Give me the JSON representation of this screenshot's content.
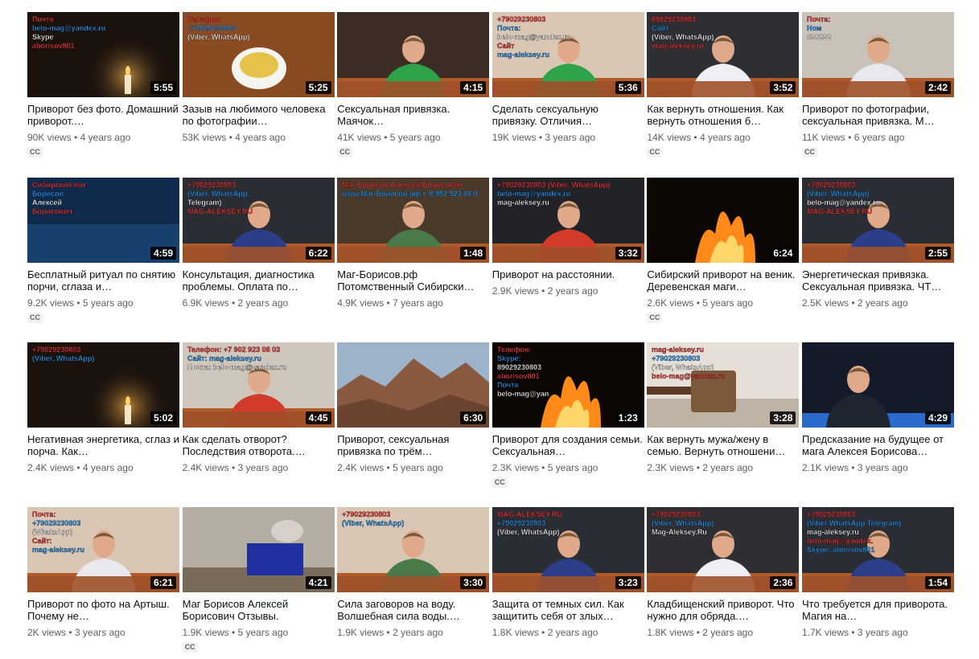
{
  "videos": [
    {
      "title": "Приворот без фото. Домашний приворот.…",
      "views": "90K views",
      "age": "4 years ago",
      "duration": "5:55",
      "cc": true,
      "scene": "candle-dark",
      "overlay": [
        "Почта",
        "belo-mag@yandex.ru",
        "Skype",
        "aborisov801"
      ],
      "palette": {
        "bg": "#1c120c",
        "accent": "#d9a24a"
      }
    },
    {
      "title": "Зазыв на любимого человека по фотографии…",
      "views": "53K views",
      "age": "4 years ago",
      "duration": "5:25",
      "cc": false,
      "scene": "bowl",
      "overlay": [
        "Телефон:",
        "+79029230803",
        "(Viber, WhatsApp)"
      ],
      "palette": {
        "bg": "#7a3a18",
        "accent": "#e6c24a"
      }
    },
    {
      "title": "Сексуальная привязка. Маячок…",
      "views": "41K views",
      "age": "5 years ago",
      "duration": "4:15",
      "cc": true,
      "scene": "man-green",
      "overlay": [],
      "palette": {
        "bg": "#3b2d25",
        "accent": "#2fa34a"
      }
    },
    {
      "title": "Сделать сексуальную привязку. Отличия…",
      "views": "19K views",
      "age": "3 years ago",
      "duration": "5:36",
      "cc": false,
      "scene": "man-green",
      "overlay": [
        "+79029230803",
        "Почта:",
        "belo-mag@yandex.ru",
        "Сайт",
        "mag-aleksey.ru"
      ],
      "palette": {
        "bg": "#d9c6b5",
        "accent": "#2fa34a"
      }
    },
    {
      "title": "Как вернуть отношения. Как вернуть отношения б…",
      "views": "14K views",
      "age": "4 years ago",
      "duration": "3:52",
      "cc": true,
      "scene": "man-room",
      "overlay": [
        "89029230803",
        "Сайт",
        "(Viber, WhatsApp)",
        "mag-aleksey.ru"
      ],
      "palette": {
        "bg": "#2e2e33",
        "accent": "#ffffff"
      }
    },
    {
      "title": "Приворот по фотографии, сексуальная привязка. М…",
      "views": "11K views",
      "age": "6 years ago",
      "duration": "2:42",
      "cc": true,
      "scene": "man-desk",
      "overlay": [
        "Почта:",
        "Ном",
        "890292"
      ],
      "palette": {
        "bg": "#c9c2b8",
        "accent": "#1a1a1a"
      }
    },
    {
      "title": "Бесплатный ритуал по снятию порчи, сглаза и…",
      "views": "9.2K views",
      "age": "5 years ago",
      "duration": "4:59",
      "cc": true,
      "scene": "title-card",
      "overlay": [
        "Сибирский маг",
        "Борисов",
        "Алексей",
        "Борисович"
      ],
      "palette": {
        "bg": "#0f2a4a",
        "accent": "#ffffff"
      }
    },
    {
      "title": "Консультация, диагностика проблемы. Оплата по…",
      "views": "6.9K views",
      "age": "2 years ago",
      "duration": "6:22",
      "cc": false,
      "scene": "man-blue",
      "overlay": [
        "+79029230803",
        "(Viber, WhatsApp,",
        "Telegram)",
        "MAG-ALEKSEY.RU"
      ],
      "palette": {
        "bg": "#2a2d33",
        "accent": "#3050a0"
      }
    },
    {
      "title": "Маг-Борисов.рф Потомственный Сибирски…",
      "views": "4.9K views",
      "age": "7 years ago",
      "duration": "1:48",
      "cc": false,
      "scene": "man-striped",
      "overlay": [
        "Маг Борисов Алексей Борисович",
        "www.Маг-Борисов.рф т. 8 902 923 08 0"
      ],
      "palette": {
        "bg": "#4a3a2c",
        "accent": "#d0a040"
      }
    },
    {
      "title": "Приворот на расстоянии.",
      "views": "2.9K views",
      "age": "2 years ago",
      "duration": "3:32",
      "cc": false,
      "scene": "man-red",
      "overlay": [
        "+79029230803 (Viber, WhatsApp)",
        "belo-mag@yandex.ru",
        "mag-aleksey.ru"
      ],
      "palette": {
        "bg": "#222328",
        "accent": "#d23a2a"
      }
    },
    {
      "title": "Сибирский приворот на веник. Деревенская маги…",
      "views": "2.6K views",
      "age": "5 years ago",
      "duration": "6:24",
      "cc": true,
      "scene": "fire",
      "overlay": [],
      "palette": {
        "bg": "#0c0604",
        "accent": "#ff8a1a"
      }
    },
    {
      "title": "Энергетическая привязка. Сексуальная привязка. ЧТ…",
      "views": "2.5K views",
      "age": "2 years ago",
      "duration": "2:55",
      "cc": false,
      "scene": "man-blue",
      "overlay": [
        "+79029230803",
        "(Viber, WhatsApp)",
        "belo-mag@yandex.ru",
        "MAG-ALEKSEY.RU"
      ],
      "palette": {
        "bg": "#2a2d33",
        "accent": "#3050a0"
      }
    },
    {
      "title": "Негативная энергетика, сглаз и порча. Как…",
      "views": "2.4K views",
      "age": "4 years ago",
      "duration": "5:02",
      "cc": false,
      "scene": "candle-dark",
      "overlay": [
        "+79029230803",
        "(Viber, WhatsApp)"
      ],
      "palette": {
        "bg": "#1a120d",
        "accent": "#e0a040"
      }
    },
    {
      "title": "Как сделать отворот? Последствия отворота.…",
      "views": "2.4K views",
      "age": "3 years ago",
      "duration": "4:45",
      "cc": false,
      "scene": "man-red",
      "overlay": [
        "Телефон: +7 902 923 08 03",
        "Сайт: mag-aleksey.ru",
        "Почта: belo-mag@yandex.ru"
      ],
      "palette": {
        "bg": "#cfc6bc",
        "accent": "#d23a2a"
      }
    },
    {
      "title": "Приворот, сексуальная привязка по трём…",
      "views": "2.4K views",
      "age": "5 years ago",
      "duration": "6:30",
      "cc": false,
      "scene": "rocks",
      "overlay": [],
      "palette": {
        "bg": "#9db3c9",
        "accent": "#8a5a40"
      }
    },
    {
      "title": "Приворот для создания семьи. Сексуальная…",
      "views": "2.3K views",
      "age": "5 years ago",
      "duration": "1:23",
      "cc": true,
      "scene": "fire",
      "overlay": [
        "Телефон:",
        "Skype:",
        "89029230803",
        "aborisov801",
        "Почта",
        "belo-mag@yan"
      ],
      "palette": {
        "bg": "#0c0604",
        "accent": "#ff8a1a"
      }
    },
    {
      "title": "Как вернуть мужа/жену в семью. Вернуть отношени…",
      "views": "2.3K views",
      "age": "2 years ago",
      "duration": "3:28",
      "cc": false,
      "scene": "box",
      "overlay": [
        "mag-aleksey.ru",
        "+79029230803",
        "(Viber, WhatsApp)",
        "belo-mag@yandex.ru"
      ],
      "palette": {
        "bg": "#e6dfd8",
        "accent": "#7a5a3a"
      }
    },
    {
      "title": "Предсказание на будущее от мага Алексея Борисова…",
      "views": "2.1K views",
      "age": "3 years ago",
      "duration": "4:29",
      "cc": false,
      "scene": "tv",
      "overlay": [],
      "palette": {
        "bg": "#141a2a",
        "accent": "#2a6acc"
      }
    },
    {
      "title": "Приворот по фото на Артыш. Почему не…",
      "views": "2K views",
      "age": "3 years ago",
      "duration": "6:21",
      "cc": false,
      "scene": "man-desk",
      "overlay": [
        "Почта:",
        "+79029230803",
        "(WhatsApp)",
        "Сайт:",
        "mag-aleksey.ru"
      ],
      "palette": {
        "bg": "#d9c6b5",
        "accent": "#ff3030"
      }
    },
    {
      "title": "Маг Борисов Алексей Борисович Отзывы.",
      "views": "1.9K views",
      "age": "5 years ago",
      "duration": "4:21",
      "cc": true,
      "scene": "room-altar",
      "overlay": [],
      "palette": {
        "bg": "#b5aca2",
        "accent": "#2030a0"
      }
    },
    {
      "title": "Сила заговоров на воду. Волшебная сила воды.…",
      "views": "1.9K views",
      "age": "2 years ago",
      "duration": "3:30",
      "cc": false,
      "scene": "man-striped",
      "overlay": [
        "+79029230803",
        "(Viber, WhatsApp)"
      ],
      "palette": {
        "bg": "#d9c6b5",
        "accent": "#d0a040"
      }
    },
    {
      "title": "Защита от темных сил. Как защитить себя от злых…",
      "views": "1.8K views",
      "age": "2 years ago",
      "duration": "3:23",
      "cc": false,
      "scene": "man-blue",
      "overlay": [
        "MAG-ALEKSEY.RU",
        "+79029230803",
        "(Viber, WhatsApp)"
      ],
      "palette": {
        "bg": "#2a2d33",
        "accent": "#3050a0"
      }
    },
    {
      "title": "Кладбищенский приворот. Что нужно для обряда.…",
      "views": "1.8K views",
      "age": "2 years ago",
      "duration": "2:36",
      "cc": false,
      "scene": "man-room",
      "overlay": [
        "+79029230803",
        "(Viber, WhatsApp)",
        "Mag-Aleksey.Ru"
      ],
      "palette": {
        "bg": "#2e2e33",
        "accent": "#ffffff"
      }
    },
    {
      "title": "Что требуется для приворота. Магия на…",
      "views": "1.7K views",
      "age": "3 years ago",
      "duration": "1:54",
      "cc": false,
      "scene": "man-blue",
      "overlay": [
        "+79029230803",
        "(Viber WhatsApp Telegram)",
        "mag-aleksey.ru",
        "belo-mag@yandex.",
        "Skype: aborisov801"
      ],
      "palette": {
        "bg": "#2a2d33",
        "accent": "#3050a0"
      }
    }
  ]
}
